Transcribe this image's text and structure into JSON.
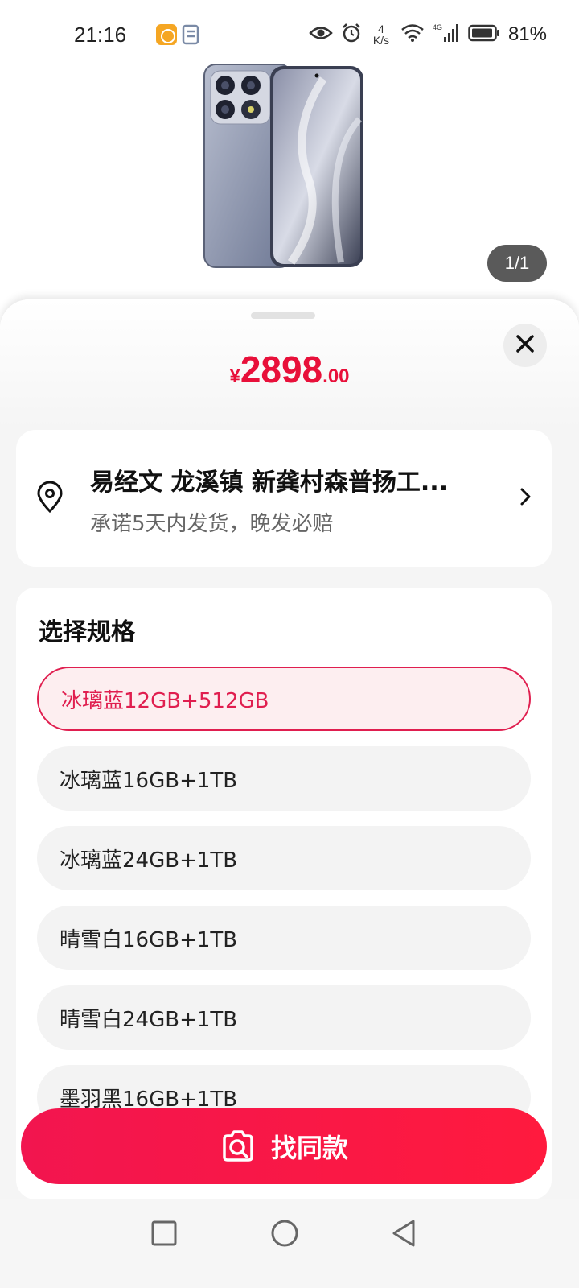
{
  "status_bar": {
    "time": "21:16",
    "speed_value": "4",
    "speed_unit": "K/s",
    "network": "4G",
    "battery_percent": "81%"
  },
  "hero": {
    "image_counter": "1/1"
  },
  "sheet": {
    "price": {
      "symbol": "¥",
      "integer": "2898",
      "decimal": ".00"
    },
    "address": {
      "title": "易经文 龙溪镇  新龚村森普扬工...",
      "subtitle": "承诺5天内发货，晚发必赔"
    },
    "spec": {
      "title": "选择规格",
      "options": [
        "冰璃蓝12GB+512GB",
        "冰璃蓝16GB+1TB",
        "冰璃蓝24GB+1TB",
        "晴雪白16GB+1TB",
        "晴雪白24GB+1TB",
        "墨羽黑16GB+1TB"
      ],
      "selected_index": 0
    }
  },
  "cta": {
    "label": "找同款"
  },
  "colors": {
    "accent": "#e8103a",
    "selected_bg": "#fdeef0"
  },
  "icons": [
    "eye-icon",
    "alarm-icon",
    "wifi-icon",
    "signal-icon",
    "battery-icon",
    "location-icon",
    "chevron-right-icon",
    "close-icon",
    "camera-search-icon",
    "square-nav-icon",
    "circle-nav-icon",
    "back-nav-icon"
  ]
}
